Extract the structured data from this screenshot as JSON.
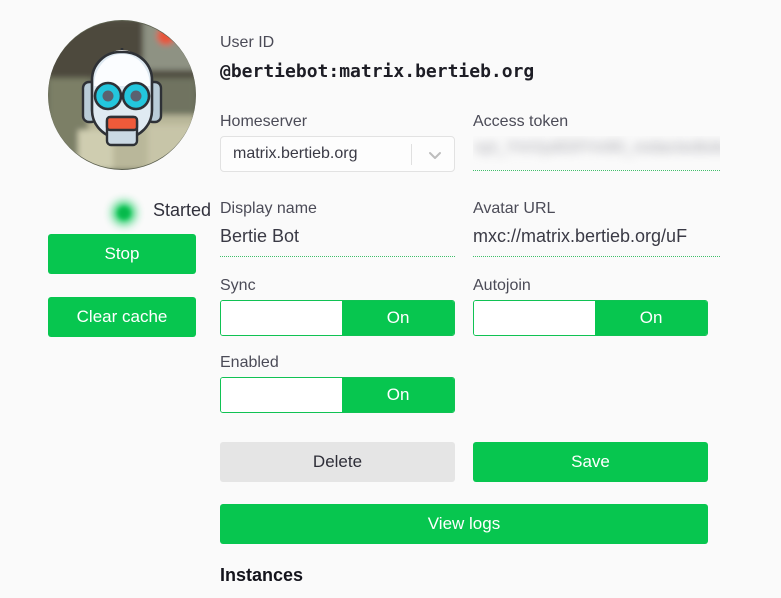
{
  "bot": {
    "status_label": "Started",
    "status_color": "#07c64f",
    "avatar_icon": "robot-avatar"
  },
  "side_actions": {
    "stop_label": "Stop",
    "clear_cache_label": "Clear cache"
  },
  "form": {
    "user_id": {
      "label": "User ID",
      "value": "@bertiebot:matrix.bertieb.org"
    },
    "homeserver": {
      "label": "Homeserver",
      "value": "matrix.bertieb.org",
      "icon": "chevron-down-icon"
    },
    "access_token": {
      "label": "Access token",
      "value": "syt_YmVydGllYm90_redactedtokenvalue_1a2B3c",
      "redacted": "true"
    },
    "display_name": {
      "label": "Display name",
      "value": "Bertie Bot"
    },
    "avatar_url": {
      "label": "Avatar URL",
      "value": "mxc://matrix.bertieb.org/uF"
    },
    "sync": {
      "label": "Sync",
      "state": "On"
    },
    "autojoin": {
      "label": "Autojoin",
      "state": "On"
    },
    "enabled": {
      "label": "Enabled",
      "state": "On"
    }
  },
  "actions": {
    "delete_label": "Delete",
    "save_label": "Save",
    "view_logs_label": "View logs"
  },
  "sections": {
    "instances_heading": "Instances"
  },
  "colors": {
    "accent_green": "#07c64f",
    "delete_grey": "#e5e5e5",
    "background": "#fafafa"
  }
}
